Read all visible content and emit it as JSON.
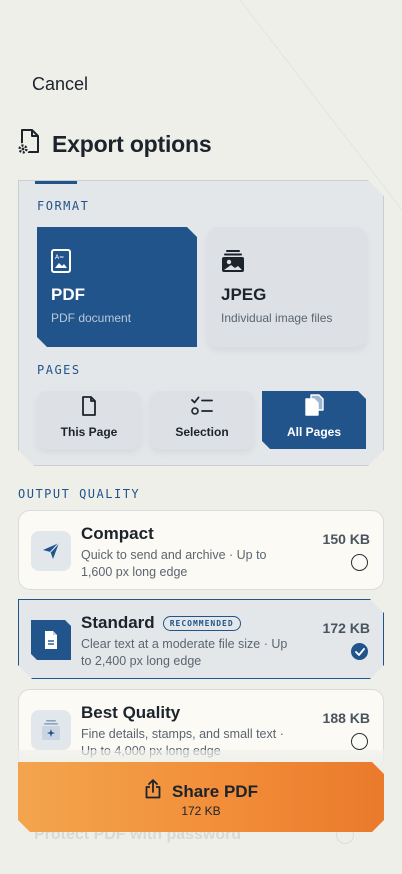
{
  "header": {
    "cancel_label": "Cancel",
    "title": "Export options"
  },
  "format": {
    "section_label": "FORMAT",
    "options": [
      {
        "name": "PDF",
        "description": "PDF document",
        "selected": true,
        "icon": "pdf-document-icon"
      },
      {
        "name": "JPEG",
        "description": "Individual image files",
        "selected": false,
        "icon": "image-stack-icon"
      }
    ]
  },
  "pages": {
    "section_label": "PAGES",
    "options": [
      {
        "label": "This Page",
        "selected": false,
        "icon": "page-icon"
      },
      {
        "label": "Selection",
        "selected": false,
        "icon": "checklist-icon"
      },
      {
        "label": "All Pages",
        "selected": true,
        "icon": "pages-stack-icon"
      }
    ]
  },
  "quality": {
    "section_label": "OUTPUT QUALITY",
    "options": [
      {
        "name": "Compact",
        "description": "Quick to send and archive · Up to 1,600 px long edge",
        "size": "150 KB",
        "selected": false,
        "icon": "paper-plane-icon"
      },
      {
        "name": "Standard",
        "badge": "RECOMMENDED",
        "description": "Clear text at a moderate file size · Up to 2,400 px long edge",
        "size": "172 KB",
        "selected": true,
        "icon": "document-icon"
      },
      {
        "name": "Best Quality",
        "description": "Fine details, stamps, and small text · Up to 4,000 px long edge",
        "size": "188 KB",
        "selected": false,
        "icon": "sparkle-document-icon"
      }
    ]
  },
  "protect": {
    "label": "Protect PDF with password"
  },
  "share": {
    "label": "Share PDF",
    "size": "172 KB"
  },
  "colors": {
    "accent": "#22548c",
    "share_gradient_start": "#f3a54e",
    "share_gradient_end": "#ea7a2c",
    "background": "#efefea"
  }
}
